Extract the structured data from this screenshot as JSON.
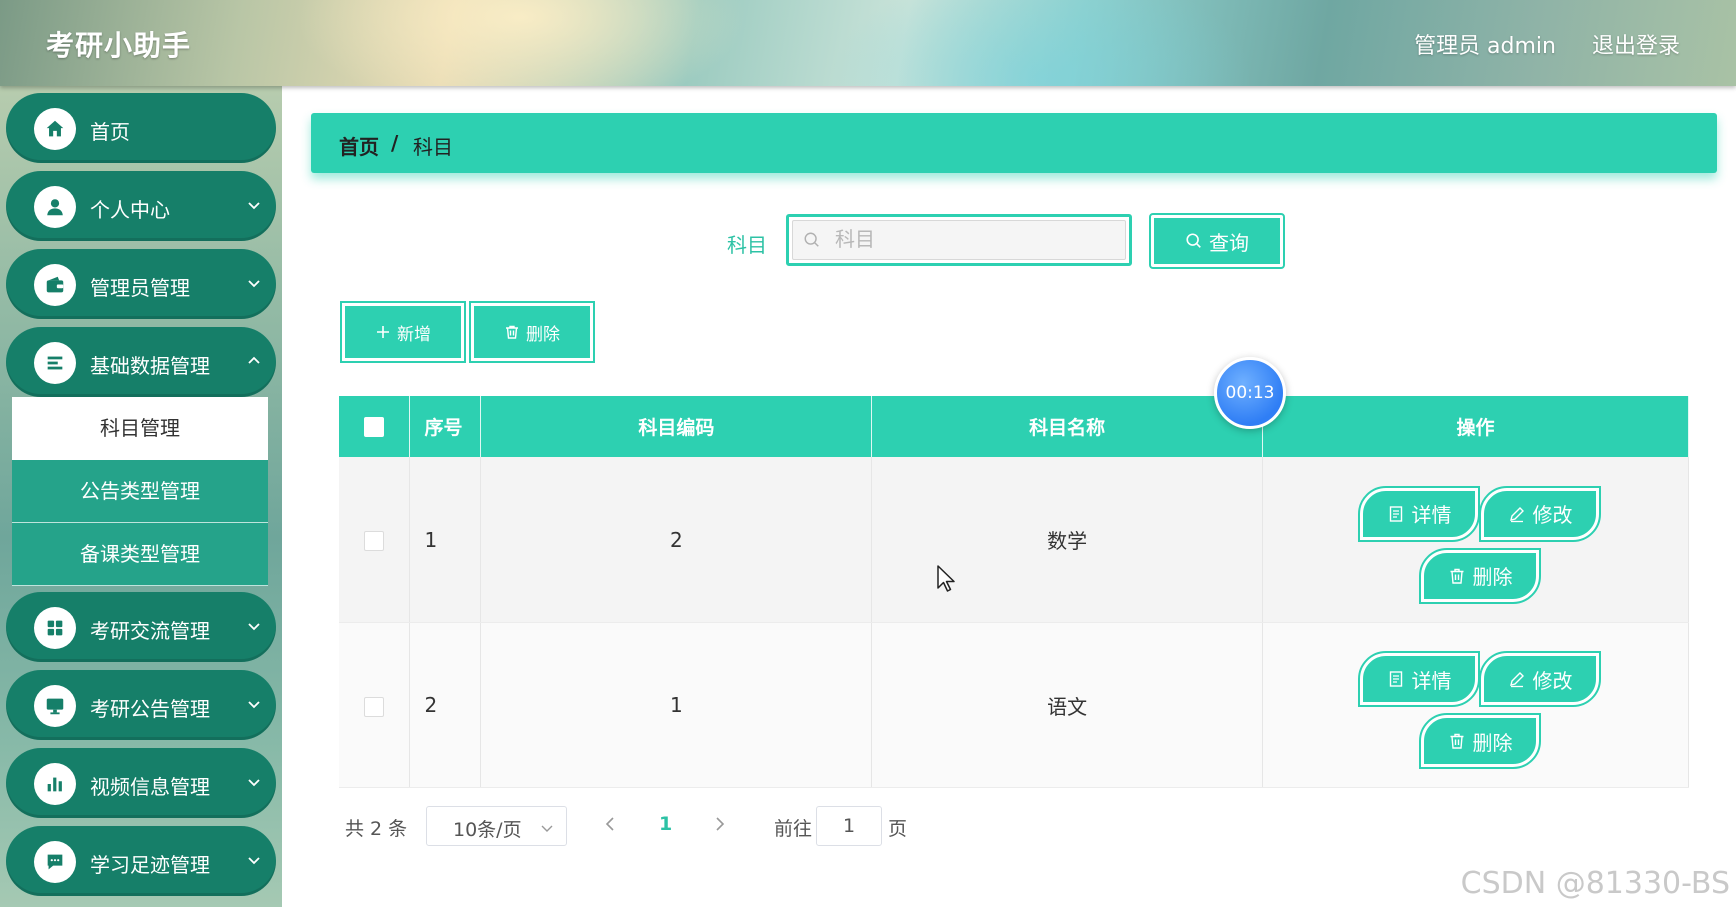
{
  "header": {
    "logo": "考研小助手",
    "user": "管理员 admin",
    "logout": "退出登录"
  },
  "sidebar": {
    "items": [
      {
        "label": "首页",
        "icon": "home-icon"
      },
      {
        "label": "个人中心",
        "icon": "user-icon"
      },
      {
        "label": "管理员管理",
        "icon": "wallet-icon"
      },
      {
        "label": "基础数据管理",
        "icon": "list-icon"
      },
      {
        "label": "考研交流管理",
        "icon": "grid-icon"
      },
      {
        "label": "考研公告管理",
        "icon": "monitor-icon"
      },
      {
        "label": "视频信息管理",
        "icon": "bar-chart-icon"
      },
      {
        "label": "学习足迹管理",
        "icon": "chat-icon"
      }
    ],
    "submenu": [
      "科目管理",
      "公告类型管理",
      "备课类型管理"
    ],
    "active_sub": "科目管理"
  },
  "breadcrumb": {
    "home": "首页",
    "separator": "/",
    "current": "科目"
  },
  "search": {
    "label": "科目",
    "placeholder": "科目",
    "value": "",
    "button": "查询"
  },
  "toolbar": {
    "add": "新增",
    "delete": "删除"
  },
  "table": {
    "headers": [
      "序号",
      "科目编码",
      "科目名称",
      "操作"
    ],
    "rows": [
      {
        "index": "1",
        "code": "2",
        "name": "数学"
      },
      {
        "index": "2",
        "code": "1",
        "name": "语文"
      }
    ],
    "actions": {
      "detail": "详情",
      "edit": "修改",
      "delete": "删除"
    }
  },
  "pagination": {
    "total": "共 2 条",
    "page_size": "10条/页",
    "current_page": "1",
    "goto_label": "前往",
    "goto_value": "1",
    "page_suffix": "页"
  },
  "overlay": {
    "timer": "00:13",
    "watermark": "CSDN @81330-BS"
  },
  "colors": {
    "accent": "#2dd0b1",
    "sidebar_item": "#167f69",
    "sub_item": "#25a38a"
  }
}
